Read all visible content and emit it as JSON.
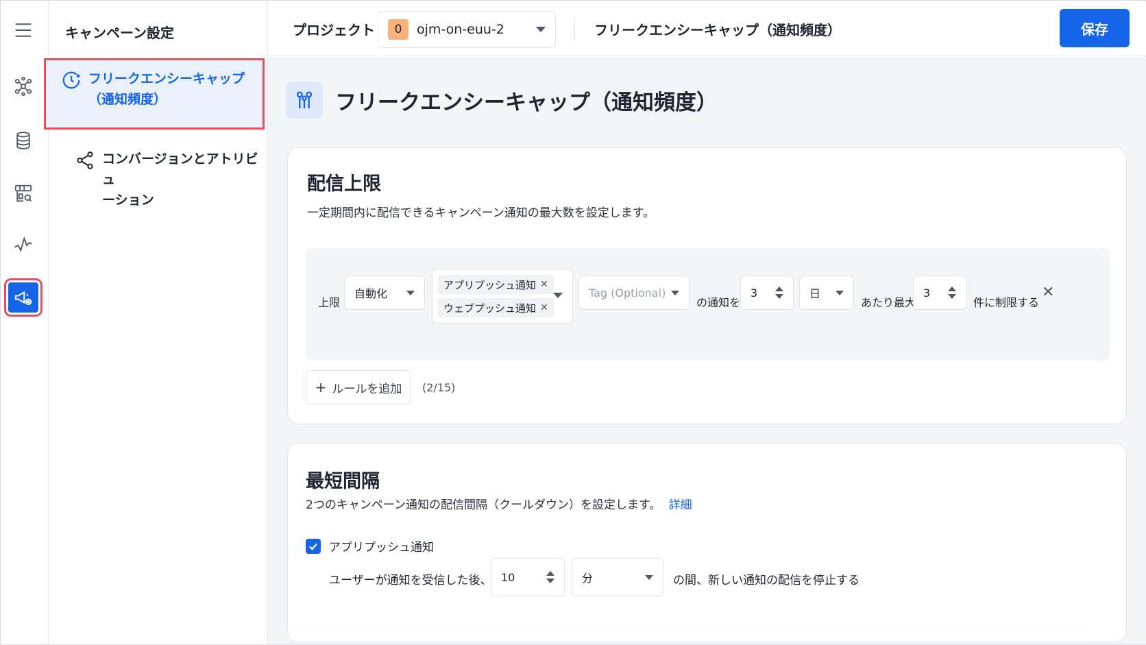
{
  "rail": {
    "items": [
      {
        "name": "menu-icon"
      },
      {
        "name": "network-icon"
      },
      {
        "name": "database-icon"
      },
      {
        "name": "store-icon"
      },
      {
        "name": "analytics-icon"
      },
      {
        "name": "campaign-settings-icon"
      }
    ]
  },
  "menu": {
    "title": "キャンペーン設定",
    "items": [
      {
        "label_line1": "フリークエンシーキャップ",
        "label_line2": "（通知頻度）",
        "icon": "clock-icon",
        "active": true
      },
      {
        "label_line1": "コンバージョンとアトリビュ",
        "label_line2": "ーション",
        "icon": "share-icon",
        "active": false
      }
    ]
  },
  "header": {
    "project_label": "プロジェクト",
    "project_badge": "0",
    "project_name": "ojm-on-euu-2",
    "title": "フリークエンシーキャップ（通知頻度）",
    "save_label": "保存"
  },
  "page": {
    "title": "フリークエンシーキャップ（通知頻度）"
  },
  "delivery_limit": {
    "title": "配信上限",
    "description": "一定期間内に配信できるキャンペーン通知の最大数を設定します。",
    "rule": {
      "label_limit": "上限",
      "type_value": "自動化",
      "tags": [
        "アプリプッシュ通知",
        "ウェブプッシュ通知"
      ],
      "tag_placeholder": "Tag (Optional)",
      "label_notifications": "の通知を",
      "period_count": "3",
      "period_unit": "日",
      "label_per_max": "あたり最大",
      "max_count": "3",
      "label_limit_to": "件に制限する"
    },
    "add_rule_label": "ルールを追加",
    "rule_count": "(2/15)"
  },
  "min_interval": {
    "title": "最短間隔",
    "description": "2つのキャンペーン通知の配信間隔（クールダウン）を設定します。",
    "details_link": "詳細",
    "app_push_label": "アプリプッシュ通知",
    "app_push_checked": true,
    "after_label": "ユーザーが通知を受信した後、",
    "interval_value": "10",
    "interval_unit": "分",
    "stop_label": "の間、新しい通知の配信を停止する"
  },
  "colors": {
    "accent": "#1565e8",
    "highlight_border": "#e5505a",
    "badge": "#f6b27b"
  }
}
